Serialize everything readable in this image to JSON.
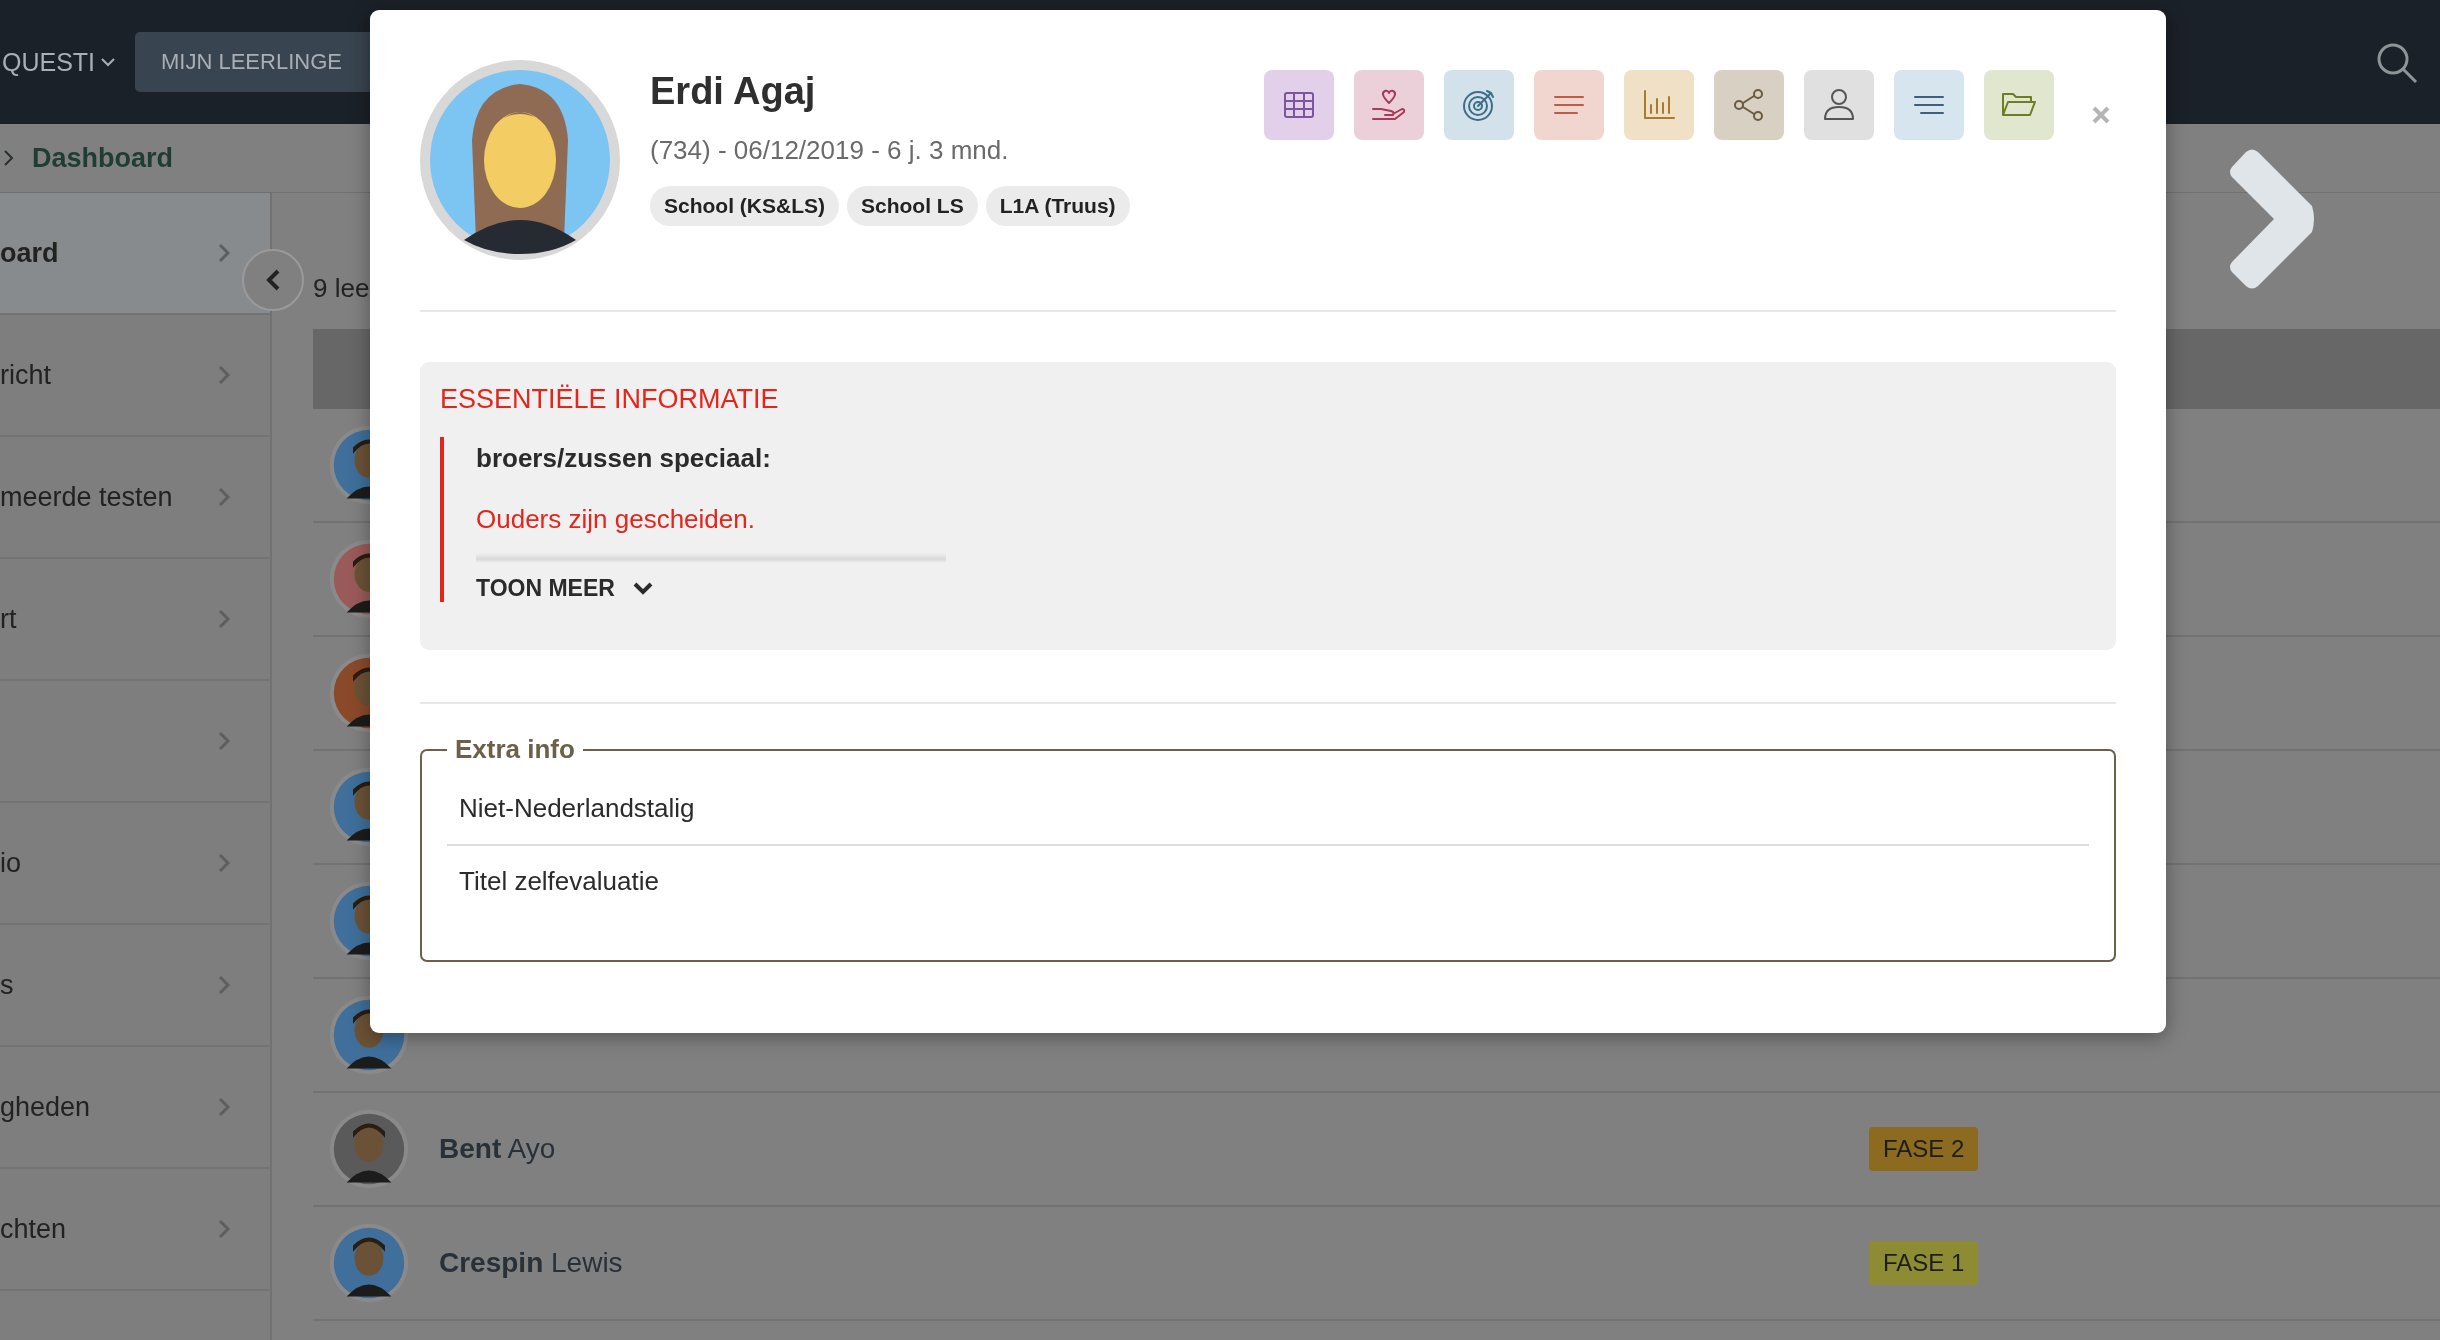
{
  "nav": {
    "menu_label": "QUESTI",
    "button": "MIJN LEERLINGE"
  },
  "breadcrumb": {
    "current": "Dashboard"
  },
  "sidebar": {
    "items": [
      {
        "label": "oard",
        "selected": true
      },
      {
        "label": "richt",
        "selected": false
      },
      {
        "label": "meerde testen",
        "selected": false
      },
      {
        "label": "rt",
        "selected": false
      },
      {
        "selected": false
      },
      {
        "label": "io",
        "selected": false
      },
      {
        "label": "s",
        "selected": false
      },
      {
        "label": "gheden",
        "selected": false
      },
      {
        "label": "chten",
        "selected": false
      }
    ]
  },
  "students": {
    "count_text": "9 lee",
    "rows": [
      {
        "kind": "covered"
      },
      {
        "kind": "covered"
      },
      {
        "kind": "covered"
      },
      {
        "kind": "covered"
      },
      {
        "kind": "covered"
      },
      {
        "kind": "covered"
      },
      {
        "kind": "named",
        "last_name": "Bent",
        "first_name": "Ayo",
        "phase": {
          "label": "FASE 2",
          "color": "#8c6a1f"
        }
      },
      {
        "kind": "named",
        "last_name": "Crespin",
        "first_name": "Lewis",
        "phase": {
          "label": "FASE 1",
          "color": "#8e8c33"
        }
      }
    ]
  },
  "modal": {
    "student": {
      "name": "Erdi Agaj",
      "details": "(734) - 06/12/2019 - 6 j. 3 mnd.",
      "tags": [
        "School (KS&LS)",
        "School LS",
        "L1A (Truus)"
      ]
    },
    "actions": [
      {
        "kind": "grid",
        "color": "#e2d0ea"
      },
      {
        "kind": "care",
        "color": "#ebd0da"
      },
      {
        "kind": "target",
        "color": "#d3e2ea"
      },
      {
        "kind": "lines",
        "color": "#f1d6d0"
      },
      {
        "kind": "chart",
        "color": "#efe0c6"
      },
      {
        "kind": "share",
        "color": "#d8d0c2"
      },
      {
        "kind": "user",
        "color": "#e0e0e0"
      },
      {
        "kind": "notes",
        "color": "#d6e5ee"
      },
      {
        "kind": "folder",
        "color": "#e1e6cf"
      }
    ],
    "essential_info": {
      "title": "ESSENTIËLE INFORMATIE",
      "heading": "broers/zussen speciaal:",
      "note": "Ouders zijn gescheiden.",
      "toggle": "TOON MEER"
    },
    "extra_info": {
      "legend": "Extra info",
      "items": [
        "Niet-Nederlandstalig",
        "Titel zelfevaluatie"
      ]
    }
  }
}
